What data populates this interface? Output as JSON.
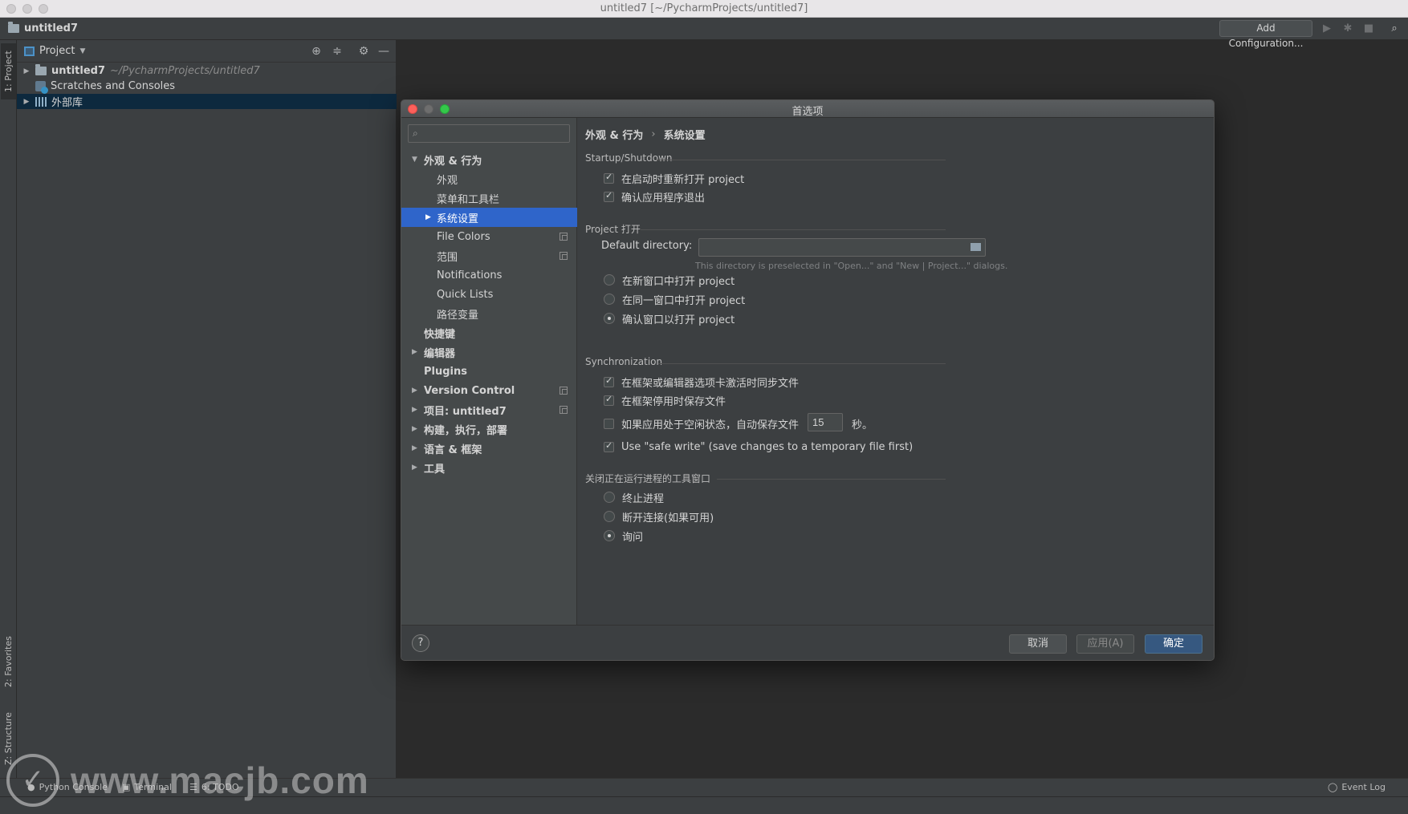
{
  "window": {
    "title": "untitled7 [~/PycharmProjects/untitled7]"
  },
  "navbar": {
    "project": "untitled7",
    "add_configuration": "Add Configuration..."
  },
  "side_tabs": {
    "project": "1: Project",
    "favorites": "2: Favorites",
    "structure": "Z: Structure"
  },
  "project_panel": {
    "title": "Project",
    "tree": [
      {
        "label": "untitled7",
        "path": "~/PycharmProjects/untitled7"
      },
      {
        "label": "Scratches and Consoles"
      },
      {
        "label": "外部库"
      }
    ]
  },
  "bottom_tabs": {
    "python_console": "Python Console",
    "terminal": "Terminal",
    "todo": "6: TODO",
    "event_log": "Event Log"
  },
  "watermark": "www.macjb.com",
  "dialog": {
    "title": "首选项",
    "search_placeholder": "",
    "nav": [
      {
        "label": "外观 & 行为"
      },
      {
        "label": "外观"
      },
      {
        "label": "菜单和工具栏"
      },
      {
        "label": "系统设置"
      },
      {
        "label": "File Colors"
      },
      {
        "label": "范围"
      },
      {
        "label": "Notifications"
      },
      {
        "label": "Quick Lists"
      },
      {
        "label": "路径变量"
      },
      {
        "label": "快捷键"
      },
      {
        "label": "编辑器"
      },
      {
        "label": "Plugins"
      },
      {
        "label": "Version Control"
      },
      {
        "label": "项目: untitled7"
      },
      {
        "label": "构建，执行，部署"
      },
      {
        "label": "语言 & 框架"
      },
      {
        "label": "工具"
      }
    ],
    "breadcrumb": [
      "外观 & 行为",
      "系统设置"
    ],
    "breadcrumb_sep": "›",
    "startup": {
      "title": "Startup/Shutdown",
      "reopen": "在启动时重新打开 project",
      "confirm_exit": "确认应用程序退出"
    },
    "project_open": {
      "title": "Project 打开",
      "default_dir_label": "Default directory:",
      "default_dir_value": "",
      "hint": "This directory is preselected in \"Open...\" and \"New | Project...\" dialogs.",
      "new_window": "在新窗口中打开 project",
      "same_window": "在同一窗口中打开 project",
      "confirm_window": "确认窗口以打开 project"
    },
    "sync": {
      "title": "Synchronization",
      "sync_on_activate": "在框架或编辑器选项卡激活时同步文件",
      "save_on_deactivate": "在框架停用时保存文件",
      "autosave_idle": "如果应用处于空闲状态，自动保存文件",
      "autosave_seconds": "15",
      "seconds_unit": "秒。",
      "safe_write": "Use \"safe write\" (save changes to a temporary file first)"
    },
    "close_process": {
      "title": "关闭正在运行进程的工具窗口",
      "terminate": "终止进程",
      "disconnect": "断开连接(如果可用)",
      "ask": "询问"
    },
    "buttons": {
      "help": "?",
      "cancel": "取消",
      "apply": "应用(A)",
      "ok": "确定"
    }
  }
}
